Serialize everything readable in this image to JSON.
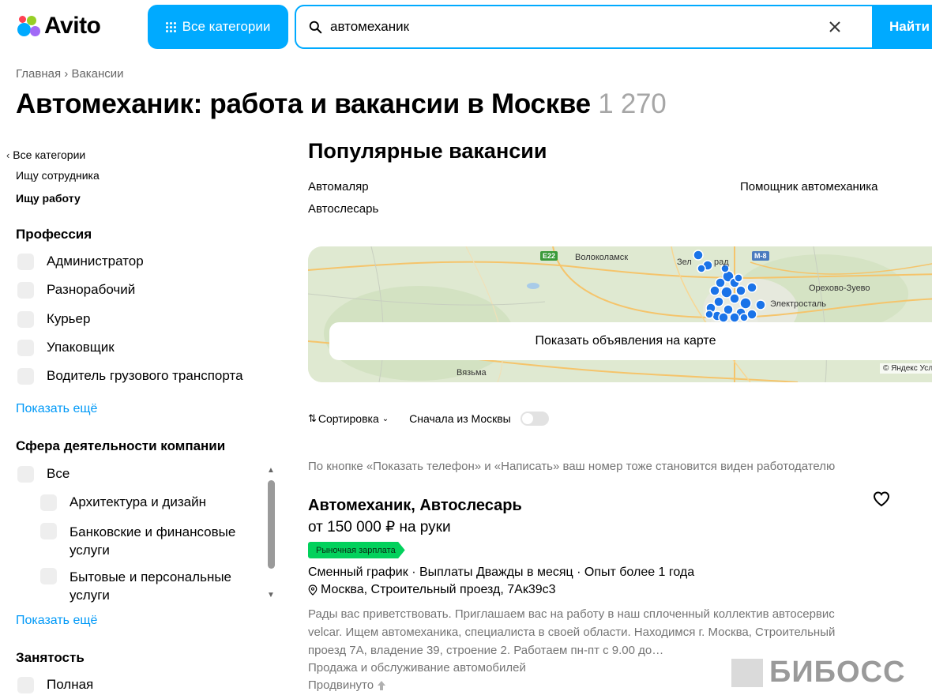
{
  "header": {
    "logo_text": "Avito",
    "categories_button": "Все категории",
    "search_value": "автомеханик",
    "search_button": "Найти"
  },
  "breadcrumb": {
    "home": "Главная",
    "separator": "›",
    "current": "Вакансии"
  },
  "page_title": "Автомеханик: работа и вакансии в Москве",
  "result_count": "1 270",
  "sidebar": {
    "back_link": "Все категории",
    "link_employer": "Ищу сотрудника",
    "link_job": "Ищу работу",
    "profession": {
      "heading": "Профессия",
      "items": [
        "Администратор",
        "Разнорабочий",
        "Курьер",
        "Упаковщик",
        "Водитель грузового транспорта"
      ],
      "show_more": "Показать ещё"
    },
    "industry": {
      "heading": "Сфера деятельности компании",
      "items": [
        "Все",
        "Архитектура и дизайн",
        "Банковские и финансовые услуги",
        "Бытовые и персональные услуги"
      ],
      "show_more": "Показать ещё"
    },
    "employment": {
      "heading": "Занятость",
      "items": [
        "Полная"
      ]
    }
  },
  "popular": {
    "title": "Популярные вакансии",
    "links": [
      "Автомаляр",
      "Помощник автомеханика",
      "Автослесарь"
    ]
  },
  "map": {
    "button": "Показать объявления на карте",
    "labels": [
      "Волоколамск",
      "Зел",
      "рад",
      "Орехово-Зуево",
      "Электросталь",
      "Вязьма"
    ],
    "road_badges": [
      "E22",
      "M-8"
    ],
    "copyright": "© Яндекс Усл"
  },
  "sort": {
    "label": "Сортировка",
    "moscow_first": "Сначала из Москвы"
  },
  "notice": "По кнопке «Показать телефон» и «Написать» ваш номер тоже становится виден работодателю",
  "vacancy": {
    "title": "Автомеханик, Автослесарь",
    "salary": "от 150 000 ₽ на руки",
    "badge": "Рыночная зарплата",
    "params": "Сменный график · Выплаты Дважды в месяц · Опыт более 1 года",
    "address": "Москва, Строительный проезд, 7Ак39с3",
    "description": "Рады вас приветствовать. Приглашаем вас на работу в наш сплоченный коллектив автосервис velcar. Ищем автомеханика, специалиста в своей области. Находимся г. Москва, Строительный проезд 7А, владение 39, строение 2. Работаем пн-пт с 9.00 до…",
    "category": "Продажа и обслуживание автомобилей",
    "promoted": "Продвинуто"
  },
  "watermark": "БИБОСС",
  "colors": {
    "accent": "#00aaff",
    "link": "#0099f7",
    "badge": "#02d15c",
    "pin": "#1a73e8"
  }
}
